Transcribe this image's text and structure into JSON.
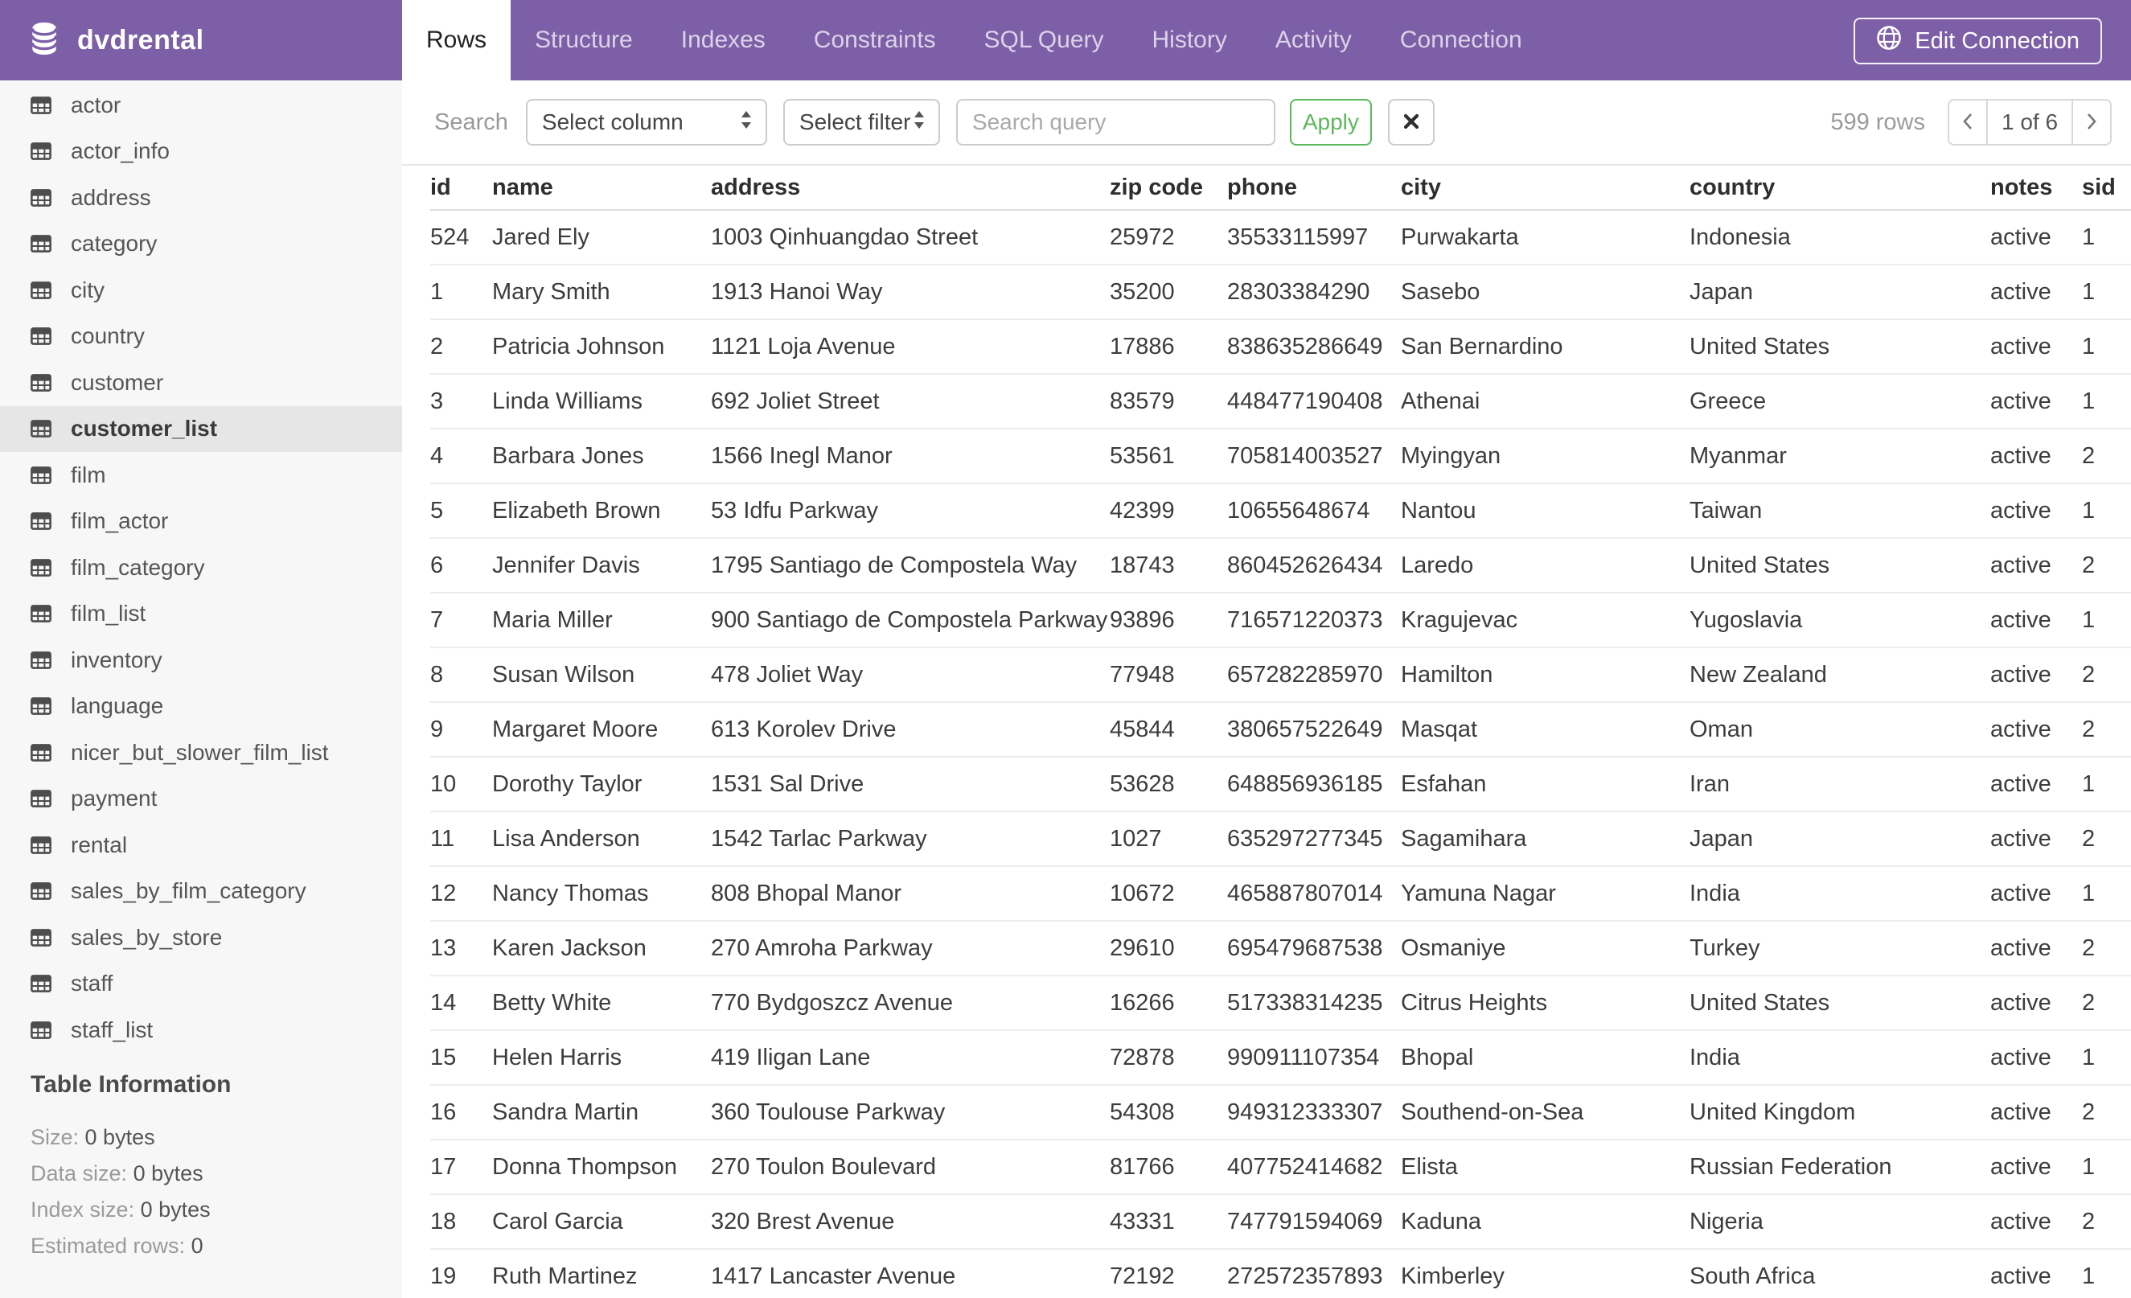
{
  "app": {
    "database_name": "dvdrental"
  },
  "header": {
    "tabs": [
      {
        "label": "Rows",
        "active": true
      },
      {
        "label": "Structure",
        "active": false
      },
      {
        "label": "Indexes",
        "active": false
      },
      {
        "label": "Constraints",
        "active": false
      },
      {
        "label": "SQL Query",
        "active": false
      },
      {
        "label": "History",
        "active": false
      },
      {
        "label": "Activity",
        "active": false
      },
      {
        "label": "Connection",
        "active": false
      }
    ],
    "edit_connection_label": "Edit Connection"
  },
  "sidebar": {
    "tables": [
      "actor",
      "actor_info",
      "address",
      "category",
      "city",
      "country",
      "customer",
      "customer_list",
      "film",
      "film_actor",
      "film_category",
      "film_list",
      "inventory",
      "language",
      "nicer_but_slower_film_list",
      "payment",
      "rental",
      "sales_by_film_category",
      "sales_by_store",
      "staff",
      "staff_list"
    ],
    "selected_table": "customer_list",
    "table_information": {
      "heading": "Table Information",
      "items": [
        {
          "label": "Size:",
          "value": "0 bytes"
        },
        {
          "label": "Data size:",
          "value": "0 bytes"
        },
        {
          "label": "Index size:",
          "value": "0 bytes"
        },
        {
          "label": "Estimated rows:",
          "value": "0"
        }
      ]
    }
  },
  "toolbar": {
    "search_label": "Search",
    "column_select_value": "Select column",
    "filter_select_value": "Select filter",
    "query_placeholder": "Search query",
    "query_value": "",
    "apply_label": "Apply",
    "rows_count_text": "599 rows",
    "pagination": {
      "current_page_text": "1 of 6"
    }
  },
  "table": {
    "columns": [
      {
        "key": "id",
        "label": "id"
      },
      {
        "key": "name",
        "label": "name"
      },
      {
        "key": "address",
        "label": "address"
      },
      {
        "key": "zip",
        "label": "zip code"
      },
      {
        "key": "phone",
        "label": "phone"
      },
      {
        "key": "city",
        "label": "city"
      },
      {
        "key": "country",
        "label": "country"
      },
      {
        "key": "notes",
        "label": "notes"
      },
      {
        "key": "sid",
        "label": "sid"
      }
    ],
    "rows": [
      {
        "id": "524",
        "name": "Jared Ely",
        "address": "1003 Qinhuangdao Street",
        "zip": "25972",
        "phone": "35533115997",
        "city": "Purwakarta",
        "country": "Indonesia",
        "notes": "active",
        "sid": "1"
      },
      {
        "id": "1",
        "name": "Mary Smith",
        "address": "1913 Hanoi Way",
        "zip": "35200",
        "phone": "28303384290",
        "city": "Sasebo",
        "country": "Japan",
        "notes": "active",
        "sid": "1"
      },
      {
        "id": "2",
        "name": "Patricia Johnson",
        "address": "1121 Loja Avenue",
        "zip": "17886",
        "phone": "838635286649",
        "city": "San Bernardino",
        "country": "United States",
        "notes": "active",
        "sid": "1"
      },
      {
        "id": "3",
        "name": "Linda Williams",
        "address": "692 Joliet Street",
        "zip": "83579",
        "phone": "448477190408",
        "city": "Athenai",
        "country": "Greece",
        "notes": "active",
        "sid": "1"
      },
      {
        "id": "4",
        "name": "Barbara Jones",
        "address": "1566 Inegl Manor",
        "zip": "53561",
        "phone": "705814003527",
        "city": "Myingyan",
        "country": "Myanmar",
        "notes": "active",
        "sid": "2"
      },
      {
        "id": "5",
        "name": "Elizabeth Brown",
        "address": "53 Idfu Parkway",
        "zip": "42399",
        "phone": "10655648674",
        "city": "Nantou",
        "country": "Taiwan",
        "notes": "active",
        "sid": "1"
      },
      {
        "id": "6",
        "name": "Jennifer Davis",
        "address": "1795 Santiago de Compostela Way",
        "zip": "18743",
        "phone": "860452626434",
        "city": "Laredo",
        "country": "United States",
        "notes": "active",
        "sid": "2"
      },
      {
        "id": "7",
        "name": "Maria Miller",
        "address": "900 Santiago de Compostela Parkway",
        "zip": "93896",
        "phone": "716571220373",
        "city": "Kragujevac",
        "country": "Yugoslavia",
        "notes": "active",
        "sid": "1"
      },
      {
        "id": "8",
        "name": "Susan Wilson",
        "address": "478 Joliet Way",
        "zip": "77948",
        "phone": "657282285970",
        "city": "Hamilton",
        "country": "New Zealand",
        "notes": "active",
        "sid": "2"
      },
      {
        "id": "9",
        "name": "Margaret Moore",
        "address": "613 Korolev Drive",
        "zip": "45844",
        "phone": "380657522649",
        "city": "Masqat",
        "country": "Oman",
        "notes": "active",
        "sid": "2"
      },
      {
        "id": "10",
        "name": "Dorothy Taylor",
        "address": "1531 Sal Drive",
        "zip": "53628",
        "phone": "648856936185",
        "city": "Esfahan",
        "country": "Iran",
        "notes": "active",
        "sid": "1"
      },
      {
        "id": "11",
        "name": "Lisa Anderson",
        "address": "1542 Tarlac Parkway",
        "zip": "1027",
        "phone": "635297277345",
        "city": "Sagamihara",
        "country": "Japan",
        "notes": "active",
        "sid": "2"
      },
      {
        "id": "12",
        "name": "Nancy Thomas",
        "address": "808 Bhopal Manor",
        "zip": "10672",
        "phone": "465887807014",
        "city": "Yamuna Nagar",
        "country": "India",
        "notes": "active",
        "sid": "1"
      },
      {
        "id": "13",
        "name": "Karen Jackson",
        "address": "270 Amroha Parkway",
        "zip": "29610",
        "phone": "695479687538",
        "city": "Osmaniye",
        "country": "Turkey",
        "notes": "active",
        "sid": "2"
      },
      {
        "id": "14",
        "name": "Betty White",
        "address": "770 Bydgoszcz Avenue",
        "zip": "16266",
        "phone": "517338314235",
        "city": "Citrus Heights",
        "country": "United States",
        "notes": "active",
        "sid": "2"
      },
      {
        "id": "15",
        "name": "Helen Harris",
        "address": "419 Iligan Lane",
        "zip": "72878",
        "phone": "990911107354",
        "city": "Bhopal",
        "country": "India",
        "notes": "active",
        "sid": "1"
      },
      {
        "id": "16",
        "name": "Sandra Martin",
        "address": "360 Toulouse Parkway",
        "zip": "54308",
        "phone": "949312333307",
        "city": "Southend-on-Sea",
        "country": "United Kingdom",
        "notes": "active",
        "sid": "2"
      },
      {
        "id": "17",
        "name": "Donna Thompson",
        "address": "270 Toulon Boulevard",
        "zip": "81766",
        "phone": "407752414682",
        "city": "Elista",
        "country": "Russian Federation",
        "notes": "active",
        "sid": "1"
      },
      {
        "id": "18",
        "name": "Carol Garcia",
        "address": "320 Brest Avenue",
        "zip": "43331",
        "phone": "747791594069",
        "city": "Kaduna",
        "country": "Nigeria",
        "notes": "active",
        "sid": "2"
      },
      {
        "id": "19",
        "name": "Ruth Martinez",
        "address": "1417 Lancaster Avenue",
        "zip": "72192",
        "phone": "272572357893",
        "city": "Kimberley",
        "country": "South Africa",
        "notes": "active",
        "sid": "1"
      }
    ]
  },
  "colors": {
    "header_purple": "#7C5FA6",
    "apply_green": "#5CB85C",
    "sidebar_bg": "#F7F7F7",
    "selected_item_bg": "#E6E6E6"
  }
}
